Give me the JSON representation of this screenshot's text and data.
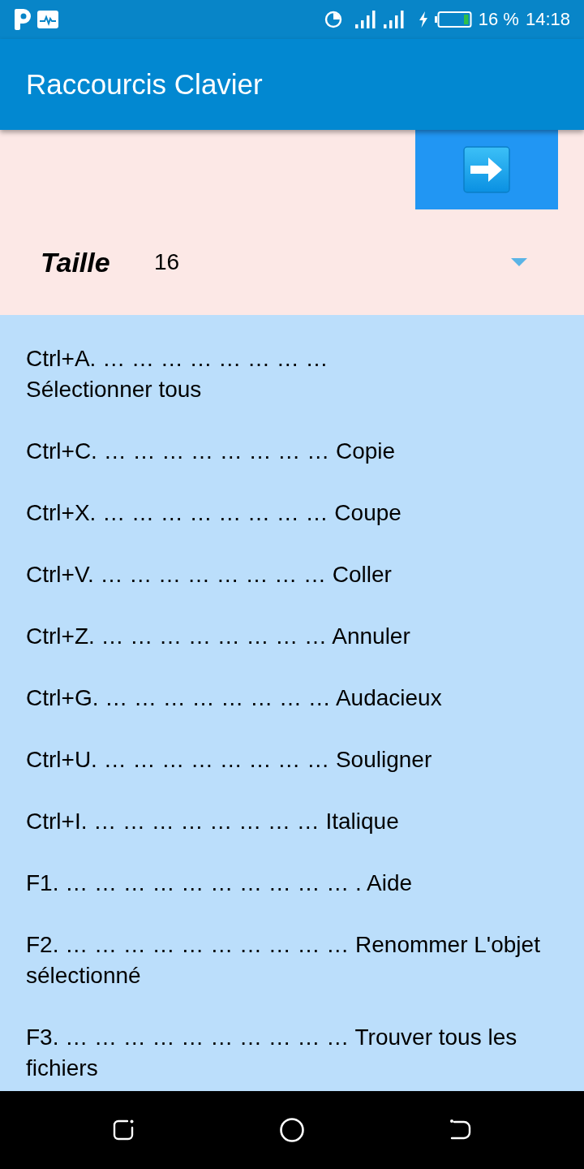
{
  "status_bar": {
    "battery": "16 %",
    "time": "14:18"
  },
  "app_bar": {
    "title": "Raccourcis Clavier"
  },
  "size_setting": {
    "label": "Taille",
    "value": "16"
  },
  "shortcuts": [
    {
      "text": "Ctrl+A. … … … … … … … …\nSélectionner tous"
    },
    {
      "text": "Ctrl+C. … … … … … … … … Copie"
    },
    {
      "text": "Ctrl+X. … … … … … … … … Coupe"
    },
    {
      "text": "Ctrl+V. … … … … … … … … Coller"
    },
    {
      "text": "Ctrl+Z. … … … … … … … … Annuler"
    },
    {
      "text": "Ctrl+G. … … … … … … … … Audacieux"
    },
    {
      "text": "Ctrl+U. … … … … … … … … Souligner"
    },
    {
      "text": "Ctrl+I. … … … … … … … … Italique"
    },
    {
      "text": "F1. … … … … … … … … … … . Aide"
    },
    {
      "text": "F2. … … … … … … … … … … Renommer L'objet sélectionné"
    },
    {
      "text": "F3. … … … … … … … … … … Trouver tous les fichiers"
    }
  ]
}
